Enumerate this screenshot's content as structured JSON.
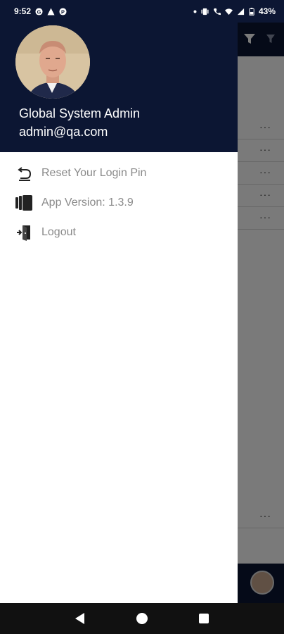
{
  "status_bar": {
    "time": "9:52",
    "battery": "43%"
  },
  "drawer": {
    "user": {
      "name": "Global System Admin",
      "email": "admin@qa.com"
    },
    "menu": [
      {
        "label": "Reset Your Login Pin",
        "icon": "reset-pin-icon"
      },
      {
        "label": "App Version: 1.3.9",
        "icon": "app-version-icon"
      },
      {
        "label": "Logout",
        "icon": "logout-icon"
      }
    ]
  },
  "background": {
    "row_action": "···"
  },
  "colors": {
    "header_navy": "#0c1633",
    "menu_text": "#8a8a8a"
  }
}
